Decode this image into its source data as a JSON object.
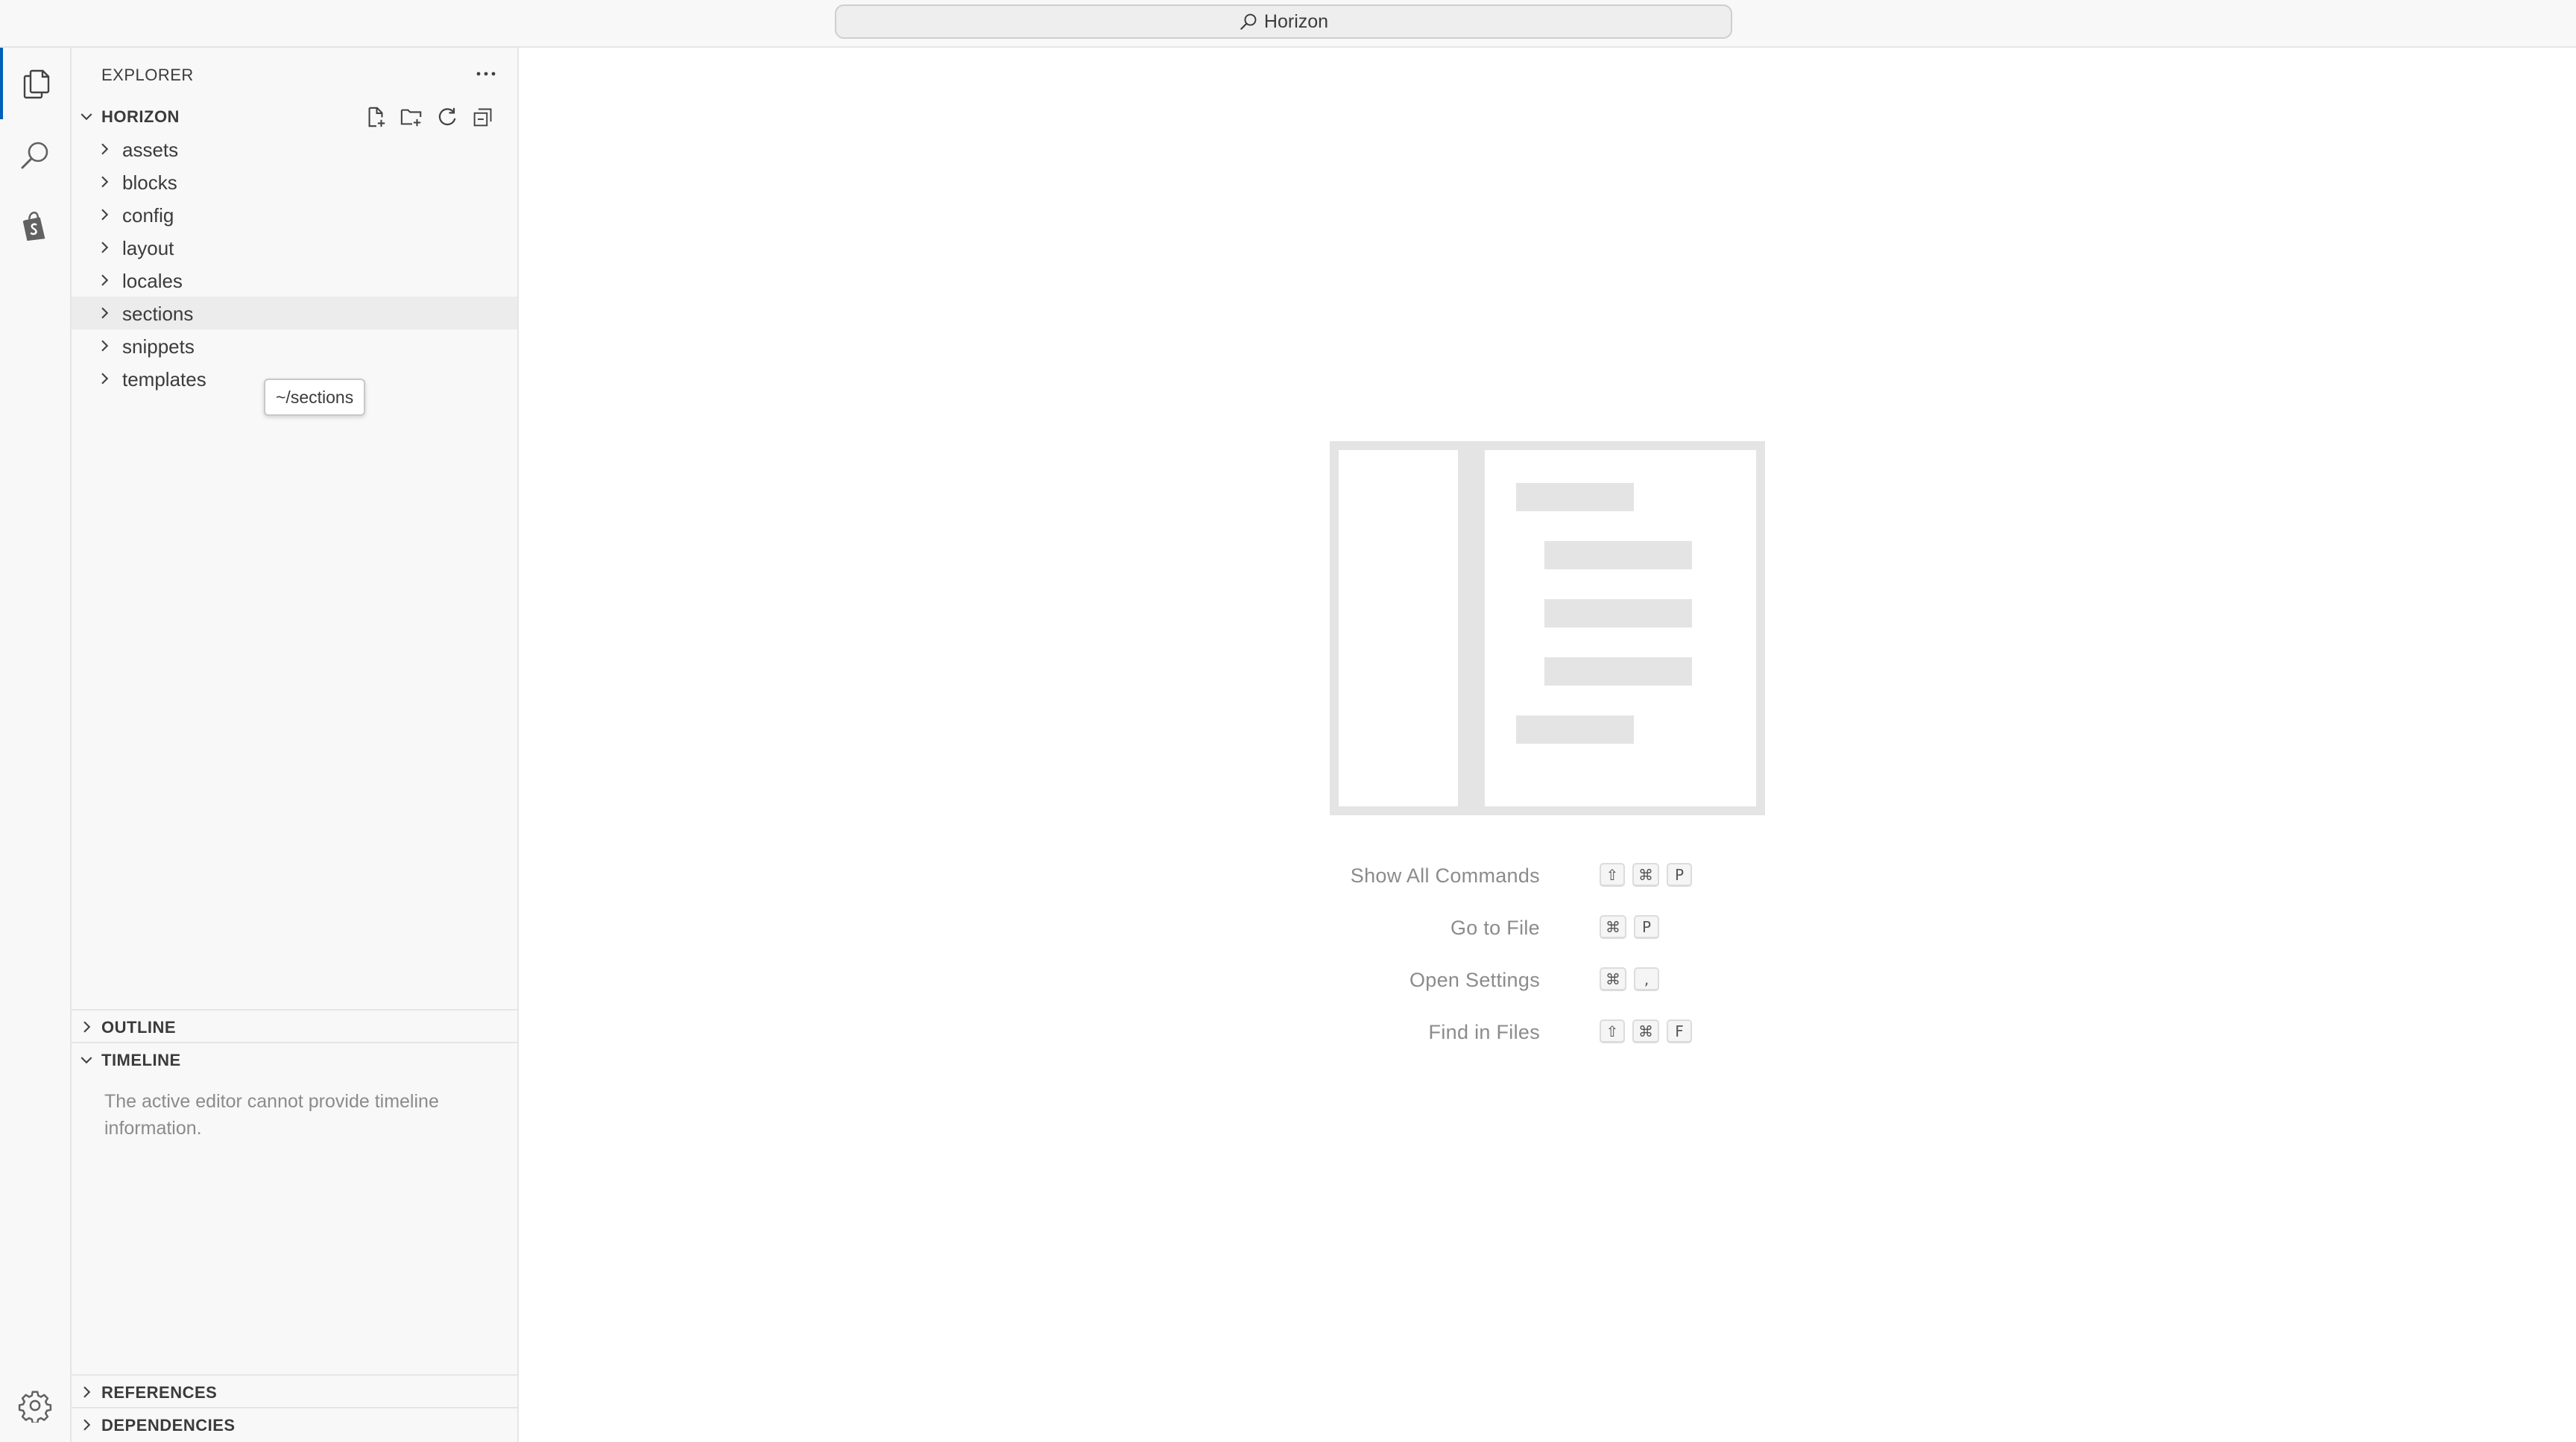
{
  "titlebar": {
    "search_label": "Horizon",
    "icons": [
      "search-icon"
    ]
  },
  "activity_bar": {
    "items": [
      {
        "name": "explorer",
        "icon": "files-icon",
        "active": true
      },
      {
        "name": "search",
        "icon": "search-icon",
        "active": false
      },
      {
        "name": "shopify",
        "icon": "shopify-bag-icon",
        "active": false
      }
    ],
    "bottom_icon": "gear-icon"
  },
  "sidebar": {
    "title": "EXPLORER",
    "more_icon": "ellipsis-icon",
    "workspace": {
      "label": "HORIZON",
      "expanded": true,
      "actions": [
        {
          "name": "new-file",
          "icon": "new-file-icon"
        },
        {
          "name": "new-folder",
          "icon": "new-folder-icon"
        },
        {
          "name": "refresh",
          "icon": "refresh-icon"
        },
        {
          "name": "collapse-all",
          "icon": "collapse-all-icon"
        }
      ]
    },
    "folders": [
      {
        "label": "assets"
      },
      {
        "label": "blocks"
      },
      {
        "label": "config"
      },
      {
        "label": "layout"
      },
      {
        "label": "locales"
      },
      {
        "label": "sections",
        "hovered": true
      },
      {
        "label": "snippets"
      },
      {
        "label": "templates"
      }
    ],
    "tooltip": "~/sections",
    "outline": {
      "label": "OUTLINE",
      "expanded": false
    },
    "timeline": {
      "label": "TIMELINE",
      "expanded": true,
      "message": "The active editor cannot provide timeline information."
    },
    "references": {
      "label": "REFERENCES",
      "expanded": false
    },
    "dependencies": {
      "label": "DEPENDENCIES",
      "expanded": false
    }
  },
  "editor": {
    "shortcuts": [
      {
        "label": "Show All Commands",
        "keys": [
          "⇧",
          "⌘",
          "P"
        ]
      },
      {
        "label": "Go to File",
        "keys": [
          "⌘",
          "P"
        ]
      },
      {
        "label": "Open Settings",
        "keys": [
          "⌘",
          ","
        ]
      },
      {
        "label": "Find in Files",
        "keys": [
          "⇧",
          "⌘",
          "F"
        ]
      }
    ]
  },
  "colors": {
    "accent": "#005fb8",
    "sidebar_bg": "#f8f8f8",
    "border": "#e5e5e5",
    "muted_text": "#8b8b8b",
    "watermark": "#e4e4e4"
  }
}
